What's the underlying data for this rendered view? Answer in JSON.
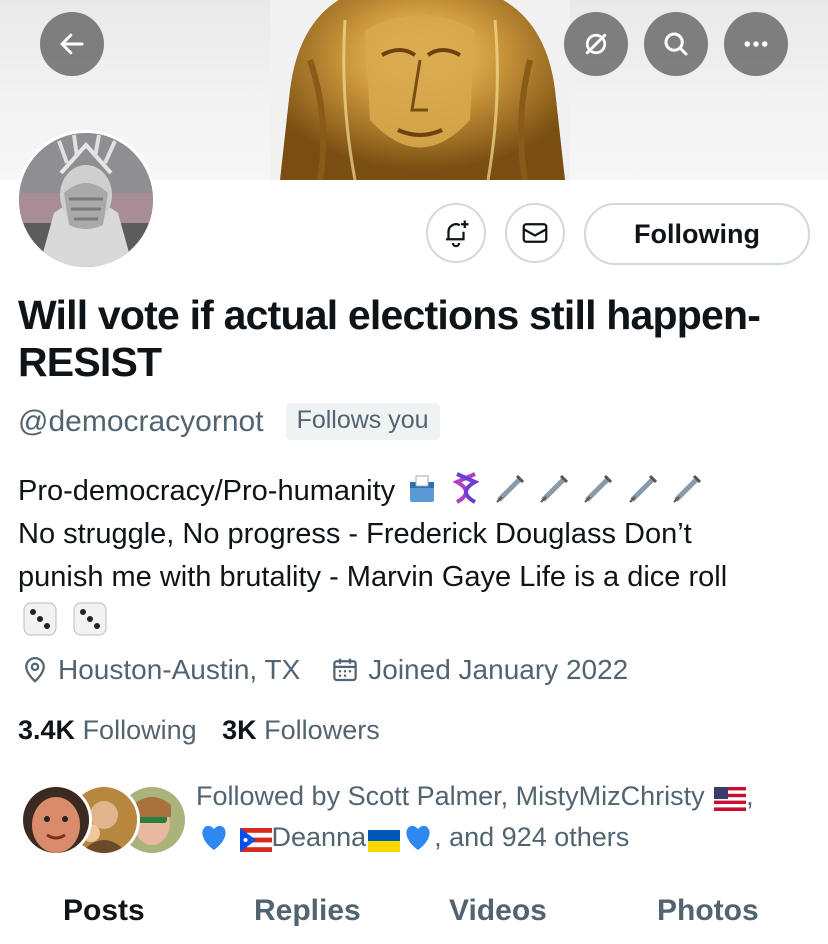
{
  "header": {
    "back_icon": "arrow-left-icon",
    "actions": [
      "grok-icon",
      "search-icon",
      "more-icon"
    ]
  },
  "profile": {
    "display_name": "Will vote if actual elections still happen-RESIST",
    "handle": "@democracyornot",
    "follows_you": "Follows you",
    "bio": {
      "line1": "Pro-democracy/Pro-humanity",
      "line2": "No struggle, No progress - Frederick Douglass Don’t",
      "line3": "punish me with brutality - Marvin Gaye Life is a dice roll"
    },
    "location": "Houston-Austin, TX",
    "joined": "Joined January 2022",
    "following_count": "3.4K",
    "following_label": "Following",
    "followers_count": "3K",
    "followers_label": "Followers"
  },
  "actions": {
    "notify_icon": "bell-plus-icon",
    "message_icon": "envelope-icon",
    "following_button": "Following"
  },
  "followed_by": {
    "line1": "Followed by Scott Palmer, MistyMizChristy",
    "name3": "Deanna",
    "suffix": ", and 924 others"
  },
  "tabs": [
    "Posts",
    "Replies",
    "Videos",
    "Photos"
  ],
  "colors": {
    "text": "#0f1419",
    "secondary": "#536471",
    "border": "#cfd9de",
    "badge_bg": "#eff3f4"
  }
}
